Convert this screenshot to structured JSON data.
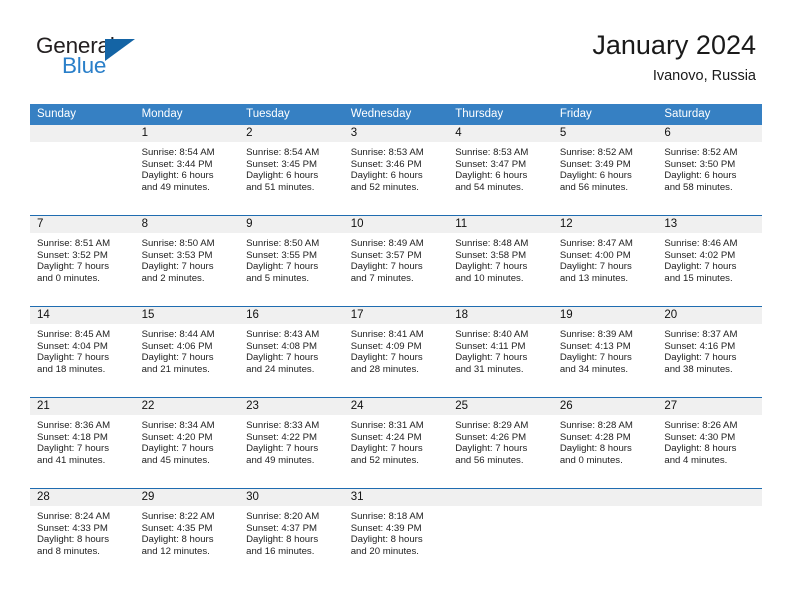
{
  "brand": {
    "name_part1": "General",
    "name_part2": "Blue",
    "triangle_color": "#1464a5",
    "blue_color": "#2a7fc9"
  },
  "header": {
    "title": "January 2024",
    "subtitle": "Ivanovo, Russia",
    "header_bg": "#3680c3",
    "row_divider": "#1f6cb0",
    "daynum_bg": "#f0f0f0"
  },
  "weekdays": [
    "Sunday",
    "Monday",
    "Tuesday",
    "Wednesday",
    "Thursday",
    "Friday",
    "Saturday"
  ],
  "labels": {
    "sunrise_prefix": "Sunrise:",
    "sunset_prefix": "Sunset:",
    "daylight_prefix": "Daylight:"
  },
  "weeks": [
    [
      {
        "empty": true,
        "day": "",
        "sunrise": "",
        "sunset": "",
        "daylight_line1": "",
        "daylight_line2": ""
      },
      {
        "empty": false,
        "day": "1",
        "sunrise": "Sunrise: 8:54 AM",
        "sunset": "Sunset: 3:44 PM",
        "daylight_line1": "Daylight: 6 hours",
        "daylight_line2": "and 49 minutes."
      },
      {
        "empty": false,
        "day": "2",
        "sunrise": "Sunrise: 8:54 AM",
        "sunset": "Sunset: 3:45 PM",
        "daylight_line1": "Daylight: 6 hours",
        "daylight_line2": "and 51 minutes."
      },
      {
        "empty": false,
        "day": "3",
        "sunrise": "Sunrise: 8:53 AM",
        "sunset": "Sunset: 3:46 PM",
        "daylight_line1": "Daylight: 6 hours",
        "daylight_line2": "and 52 minutes."
      },
      {
        "empty": false,
        "day": "4",
        "sunrise": "Sunrise: 8:53 AM",
        "sunset": "Sunset: 3:47 PM",
        "daylight_line1": "Daylight: 6 hours",
        "daylight_line2": "and 54 minutes."
      },
      {
        "empty": false,
        "day": "5",
        "sunrise": "Sunrise: 8:52 AM",
        "sunset": "Sunset: 3:49 PM",
        "daylight_line1": "Daylight: 6 hours",
        "daylight_line2": "and 56 minutes."
      },
      {
        "empty": false,
        "day": "6",
        "sunrise": "Sunrise: 8:52 AM",
        "sunset": "Sunset: 3:50 PM",
        "daylight_line1": "Daylight: 6 hours",
        "daylight_line2": "and 58 minutes."
      }
    ],
    [
      {
        "empty": false,
        "day": "7",
        "sunrise": "Sunrise: 8:51 AM",
        "sunset": "Sunset: 3:52 PM",
        "daylight_line1": "Daylight: 7 hours",
        "daylight_line2": "and 0 minutes."
      },
      {
        "empty": false,
        "day": "8",
        "sunrise": "Sunrise: 8:50 AM",
        "sunset": "Sunset: 3:53 PM",
        "daylight_line1": "Daylight: 7 hours",
        "daylight_line2": "and 2 minutes."
      },
      {
        "empty": false,
        "day": "9",
        "sunrise": "Sunrise: 8:50 AM",
        "sunset": "Sunset: 3:55 PM",
        "daylight_line1": "Daylight: 7 hours",
        "daylight_line2": "and 5 minutes."
      },
      {
        "empty": false,
        "day": "10",
        "sunrise": "Sunrise: 8:49 AM",
        "sunset": "Sunset: 3:57 PM",
        "daylight_line1": "Daylight: 7 hours",
        "daylight_line2": "and 7 minutes."
      },
      {
        "empty": false,
        "day": "11",
        "sunrise": "Sunrise: 8:48 AM",
        "sunset": "Sunset: 3:58 PM",
        "daylight_line1": "Daylight: 7 hours",
        "daylight_line2": "and 10 minutes."
      },
      {
        "empty": false,
        "day": "12",
        "sunrise": "Sunrise: 8:47 AM",
        "sunset": "Sunset: 4:00 PM",
        "daylight_line1": "Daylight: 7 hours",
        "daylight_line2": "and 13 minutes."
      },
      {
        "empty": false,
        "day": "13",
        "sunrise": "Sunrise: 8:46 AM",
        "sunset": "Sunset: 4:02 PM",
        "daylight_line1": "Daylight: 7 hours",
        "daylight_line2": "and 15 minutes."
      }
    ],
    [
      {
        "empty": false,
        "day": "14",
        "sunrise": "Sunrise: 8:45 AM",
        "sunset": "Sunset: 4:04 PM",
        "daylight_line1": "Daylight: 7 hours",
        "daylight_line2": "and 18 minutes."
      },
      {
        "empty": false,
        "day": "15",
        "sunrise": "Sunrise: 8:44 AM",
        "sunset": "Sunset: 4:06 PM",
        "daylight_line1": "Daylight: 7 hours",
        "daylight_line2": "and 21 minutes."
      },
      {
        "empty": false,
        "day": "16",
        "sunrise": "Sunrise: 8:43 AM",
        "sunset": "Sunset: 4:08 PM",
        "daylight_line1": "Daylight: 7 hours",
        "daylight_line2": "and 24 minutes."
      },
      {
        "empty": false,
        "day": "17",
        "sunrise": "Sunrise: 8:41 AM",
        "sunset": "Sunset: 4:09 PM",
        "daylight_line1": "Daylight: 7 hours",
        "daylight_line2": "and 28 minutes."
      },
      {
        "empty": false,
        "day": "18",
        "sunrise": "Sunrise: 8:40 AM",
        "sunset": "Sunset: 4:11 PM",
        "daylight_line1": "Daylight: 7 hours",
        "daylight_line2": "and 31 minutes."
      },
      {
        "empty": false,
        "day": "19",
        "sunrise": "Sunrise: 8:39 AM",
        "sunset": "Sunset: 4:13 PM",
        "daylight_line1": "Daylight: 7 hours",
        "daylight_line2": "and 34 minutes."
      },
      {
        "empty": false,
        "day": "20",
        "sunrise": "Sunrise: 8:37 AM",
        "sunset": "Sunset: 4:16 PM",
        "daylight_line1": "Daylight: 7 hours",
        "daylight_line2": "and 38 minutes."
      }
    ],
    [
      {
        "empty": false,
        "day": "21",
        "sunrise": "Sunrise: 8:36 AM",
        "sunset": "Sunset: 4:18 PM",
        "daylight_line1": "Daylight: 7 hours",
        "daylight_line2": "and 41 minutes."
      },
      {
        "empty": false,
        "day": "22",
        "sunrise": "Sunrise: 8:34 AM",
        "sunset": "Sunset: 4:20 PM",
        "daylight_line1": "Daylight: 7 hours",
        "daylight_line2": "and 45 minutes."
      },
      {
        "empty": false,
        "day": "23",
        "sunrise": "Sunrise: 8:33 AM",
        "sunset": "Sunset: 4:22 PM",
        "daylight_line1": "Daylight: 7 hours",
        "daylight_line2": "and 49 minutes."
      },
      {
        "empty": false,
        "day": "24",
        "sunrise": "Sunrise: 8:31 AM",
        "sunset": "Sunset: 4:24 PM",
        "daylight_line1": "Daylight: 7 hours",
        "daylight_line2": "and 52 minutes."
      },
      {
        "empty": false,
        "day": "25",
        "sunrise": "Sunrise: 8:29 AM",
        "sunset": "Sunset: 4:26 PM",
        "daylight_line1": "Daylight: 7 hours",
        "daylight_line2": "and 56 minutes."
      },
      {
        "empty": false,
        "day": "26",
        "sunrise": "Sunrise: 8:28 AM",
        "sunset": "Sunset: 4:28 PM",
        "daylight_line1": "Daylight: 8 hours",
        "daylight_line2": "and 0 minutes."
      },
      {
        "empty": false,
        "day": "27",
        "sunrise": "Sunrise: 8:26 AM",
        "sunset": "Sunset: 4:30 PM",
        "daylight_line1": "Daylight: 8 hours",
        "daylight_line2": "and 4 minutes."
      }
    ],
    [
      {
        "empty": false,
        "day": "28",
        "sunrise": "Sunrise: 8:24 AM",
        "sunset": "Sunset: 4:33 PM",
        "daylight_line1": "Daylight: 8 hours",
        "daylight_line2": "and 8 minutes."
      },
      {
        "empty": false,
        "day": "29",
        "sunrise": "Sunrise: 8:22 AM",
        "sunset": "Sunset: 4:35 PM",
        "daylight_line1": "Daylight: 8 hours",
        "daylight_line2": "and 12 minutes."
      },
      {
        "empty": false,
        "day": "30",
        "sunrise": "Sunrise: 8:20 AM",
        "sunset": "Sunset: 4:37 PM",
        "daylight_line1": "Daylight: 8 hours",
        "daylight_line2": "and 16 minutes."
      },
      {
        "empty": false,
        "day": "31",
        "sunrise": "Sunrise: 8:18 AM",
        "sunset": "Sunset: 4:39 PM",
        "daylight_line1": "Daylight: 8 hours",
        "daylight_line2": "and 20 minutes."
      },
      {
        "empty": true,
        "day": "",
        "sunrise": "",
        "sunset": "",
        "daylight_line1": "",
        "daylight_line2": ""
      },
      {
        "empty": true,
        "day": "",
        "sunrise": "",
        "sunset": "",
        "daylight_line1": "",
        "daylight_line2": ""
      },
      {
        "empty": true,
        "day": "",
        "sunrise": "",
        "sunset": "",
        "daylight_line1": "",
        "daylight_line2": ""
      }
    ]
  ]
}
